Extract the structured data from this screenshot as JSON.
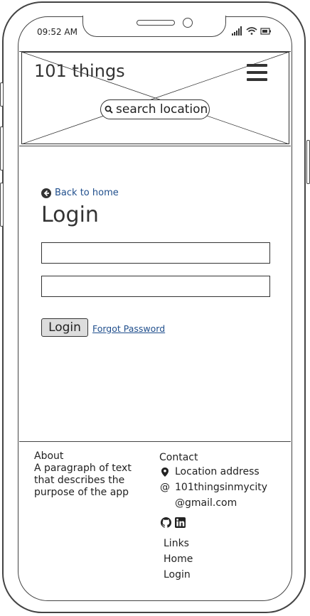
{
  "status_bar": {
    "time": "09:52 AM"
  },
  "header": {
    "logo": "101 things",
    "search_label": "search location"
  },
  "login": {
    "back_link": "Back to home",
    "title": "Login",
    "username_value": "",
    "password_value": "",
    "login_button": "Login",
    "forgot_link": "Forgot Password"
  },
  "footer": {
    "about_heading": "About",
    "about_lines": [
      "A paragraph of text",
      "that describes the",
      "purpose of the app"
    ],
    "contact_heading": "Contact",
    "location": "Location address",
    "email_line1": "101thingsinmycity",
    "email_line2": "@gmail.com",
    "email_at": "@",
    "social_icons": [
      "github-icon",
      "linkedin-icon"
    ],
    "links": [
      "Links",
      "Home",
      "Login"
    ]
  }
}
